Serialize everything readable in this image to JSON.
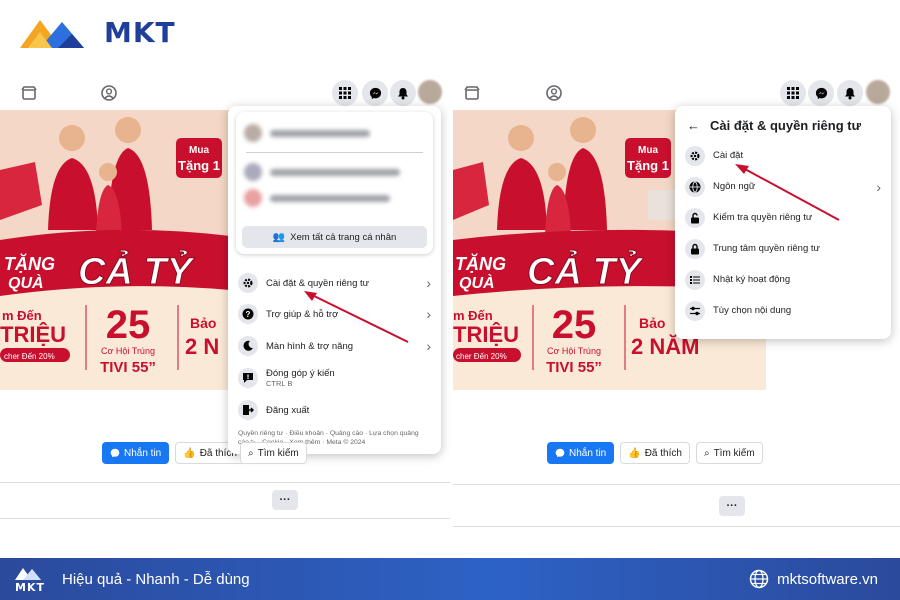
{
  "brand": {
    "name": "MKT",
    "slogan": "Hiệu quả - Nhanh - Dễ dùng",
    "website": "mktsoftware.vn",
    "primary_color": "#1f3f9b",
    "accent_color": "#2d62c5"
  },
  "banner": {
    "promo_badge_1": "Mua",
    "promo_badge_2": "Tặng 1",
    "headline_1": "TẶNG",
    "headline_2": "QUÀ",
    "headline_3": "CẢ TỶ",
    "left_1": "m Đến",
    "left_2": "TRIỆU",
    "left_3": "cher Đến 20%",
    "mid_num": "25",
    "mid_1": "Cơ Hội Trúng",
    "mid_2": "TIVI 55”",
    "right_1": "Bảo",
    "right_2": "2 N",
    "right_2_full": "2 NĂM",
    "colors": {
      "red": "#c8102e",
      "cream": "#fbe9d7"
    }
  },
  "left_panel": {
    "see_all_profiles": "Xem tất cả trang cá nhân",
    "menu": [
      {
        "label": "Cài đặt & quyền riêng tư",
        "icon": "gear-icon"
      },
      {
        "label": "Trợ giúp & hỗ trợ",
        "icon": "help-icon"
      },
      {
        "label": "Màn hình & trợ năng",
        "icon": "moon-icon"
      },
      {
        "label": "Đóng góp ý kiến",
        "sub": "CTRL B",
        "icon": "feedback-icon"
      },
      {
        "label": "Đăng xuất",
        "icon": "logout-icon"
      }
    ],
    "footer": "Quyền riêng tư · Điều khoản · Quảng cáo · Lựa chọn quảng cáo ▷ · Cookie · Xem thêm · Meta © 2024",
    "actions": {
      "message": "Nhắn tin",
      "liked": "Đã thích",
      "search_partial": "Tìm kiếm"
    }
  },
  "right_panel": {
    "title": "Cài đặt & quyền riêng tư",
    "menu": [
      {
        "label": "Cài đặt",
        "icon": "gear-icon"
      },
      {
        "label": "Ngôn ngữ",
        "icon": "globe-icon"
      },
      {
        "label": "Kiểm tra quyền riêng tư",
        "icon": "lock-open-icon"
      },
      {
        "label": "Trung tâm quyền riêng tư",
        "icon": "lock-icon"
      },
      {
        "label": "Nhật ký hoạt động",
        "icon": "list-icon"
      },
      {
        "label": "Tùy chọn nội dung",
        "icon": "sliders-icon"
      }
    ],
    "actions": {
      "message": "Nhắn tin",
      "liked": "Đã thích",
      "search": "Tìm kiếm"
    }
  },
  "more_label": "···"
}
